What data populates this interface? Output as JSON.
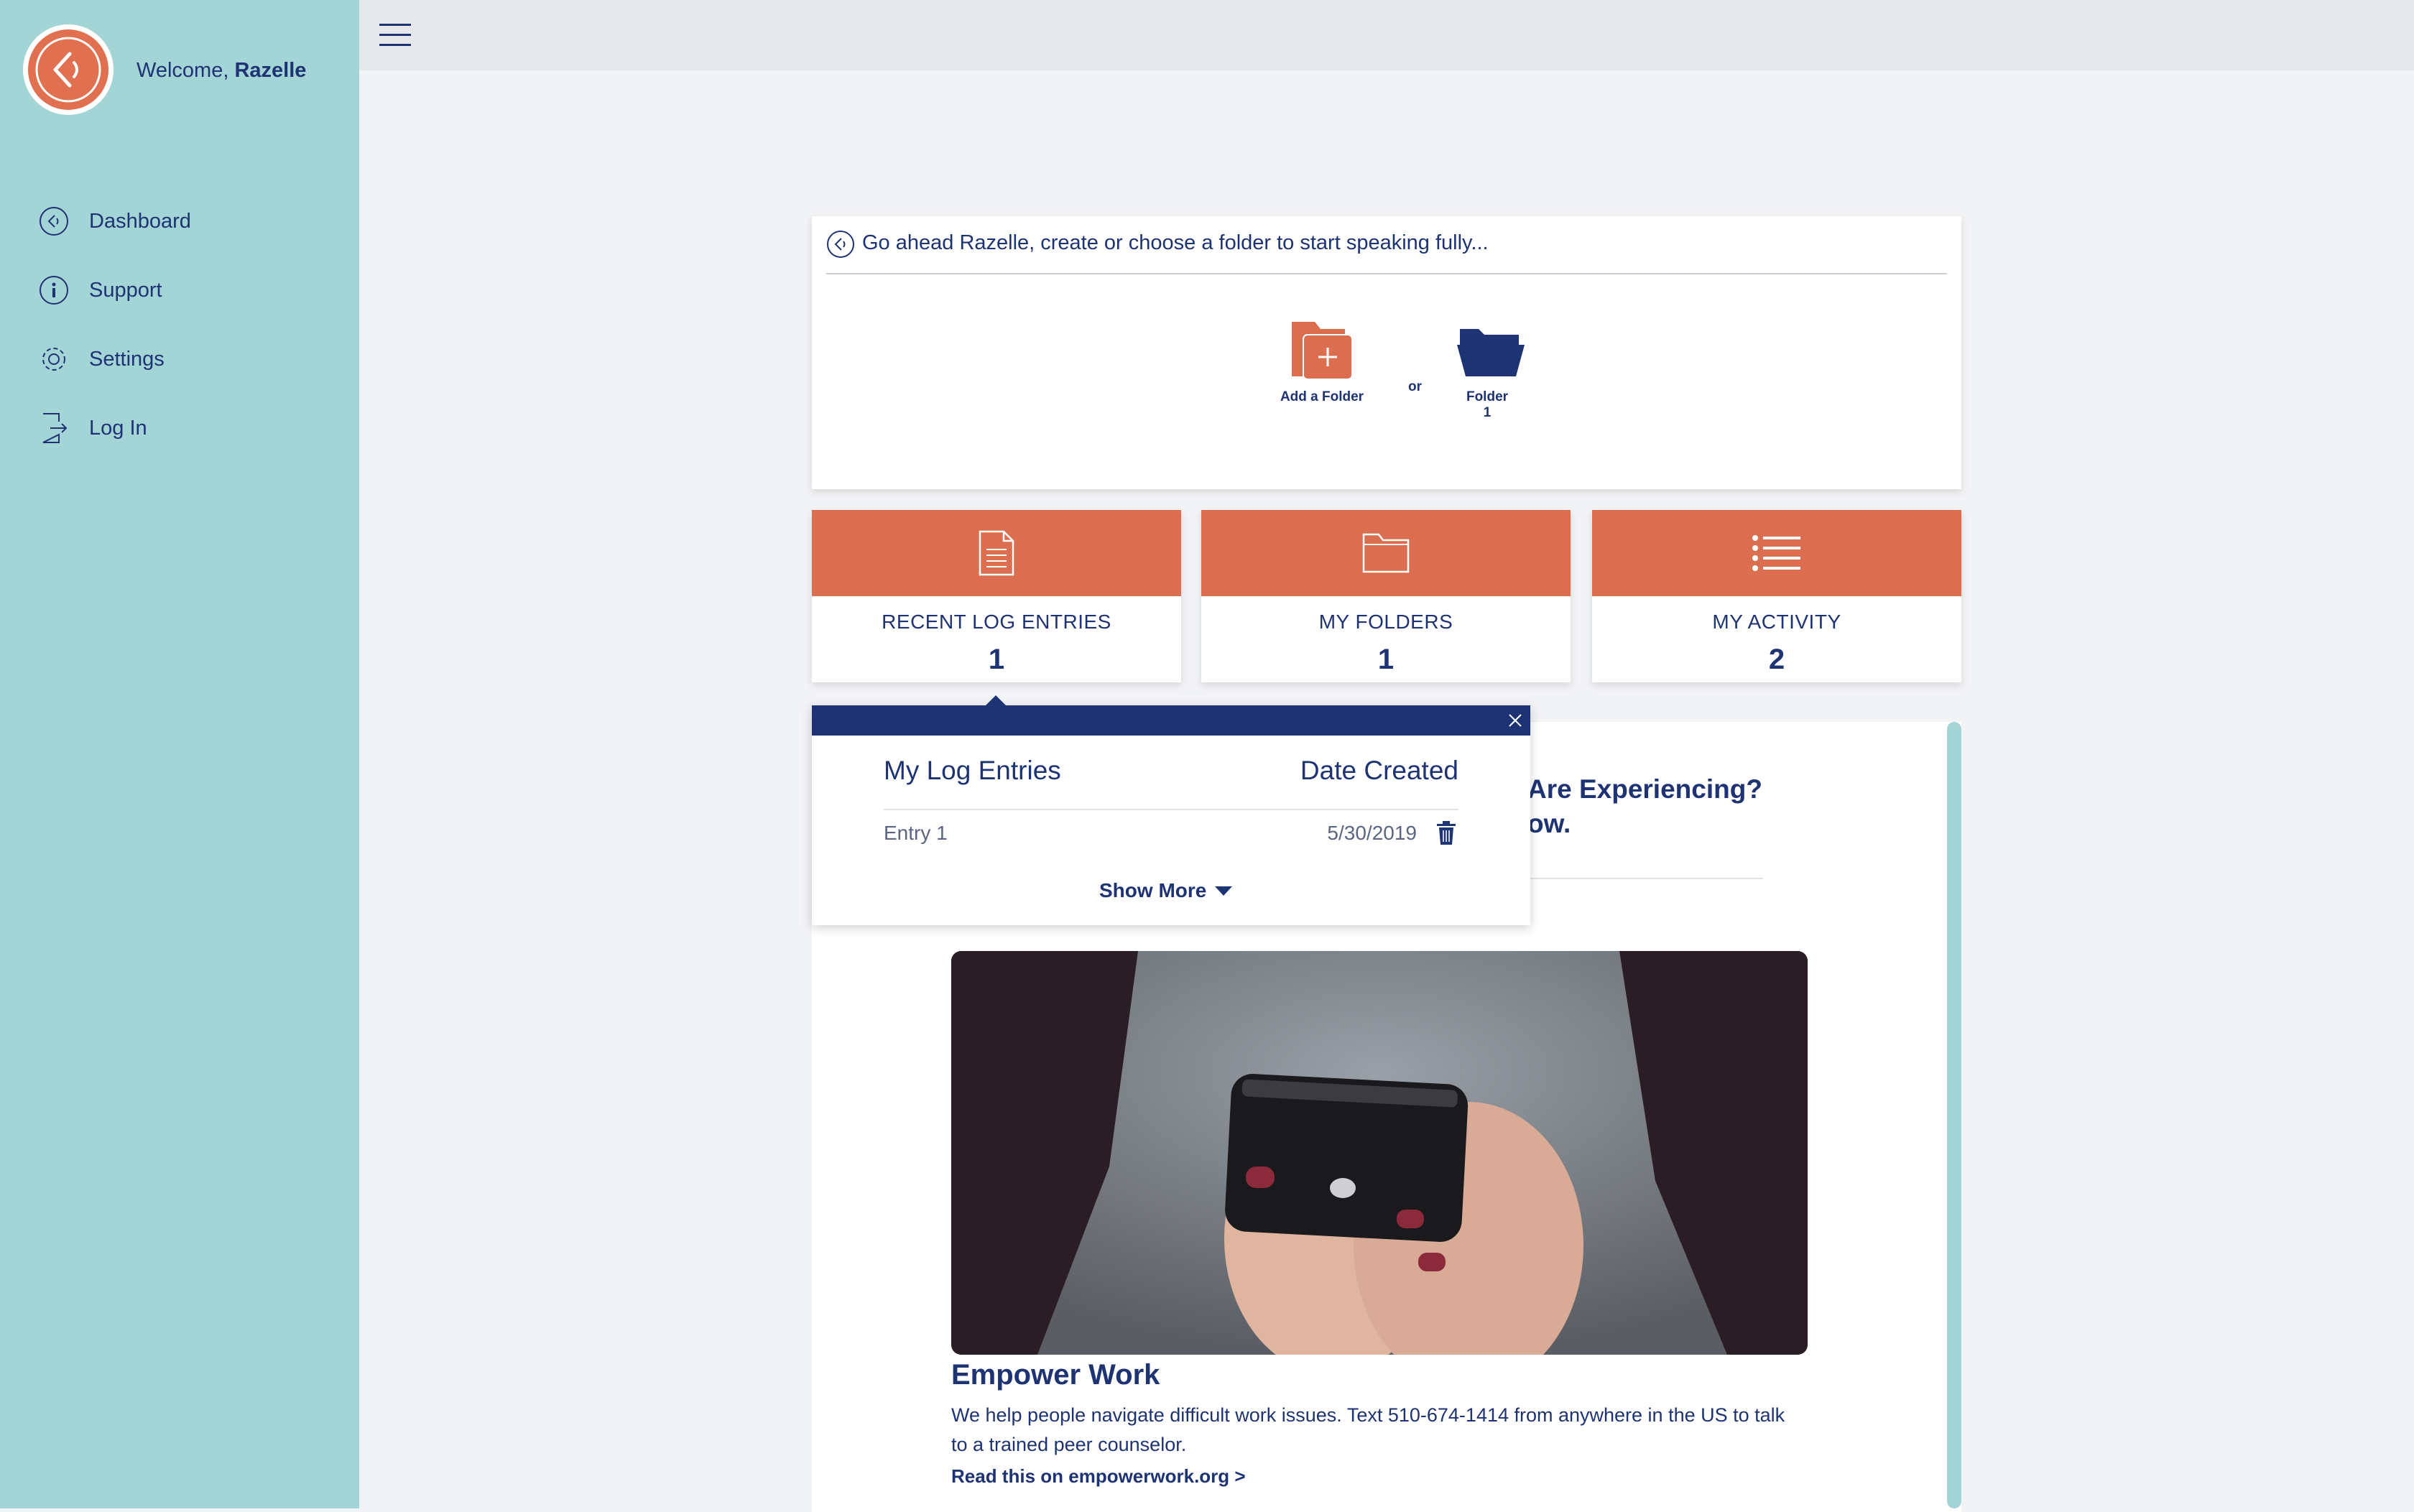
{
  "sidebar": {
    "welcome_prefix": "Welcome, ",
    "user_name": "Razelle",
    "nav": [
      {
        "label": "Dashboard",
        "icon": "back-circle-icon"
      },
      {
        "label": "Support",
        "icon": "info-icon"
      },
      {
        "label": "Settings",
        "icon": "gear-icon"
      },
      {
        "label": "Log In",
        "icon": "login-door-icon"
      }
    ]
  },
  "topbar": {
    "menu_icon": "hamburger-icon"
  },
  "folders": {
    "prompt": "Go ahead Razelle, create or choose a folder to start speaking fully...",
    "add_label": "Add a Folder",
    "or_label": "or",
    "folder_name": "Folder",
    "folder_number": "1"
  },
  "stats": [
    {
      "label": "RECENT LOG ENTRIES",
      "value": "1",
      "icon": "document-icon"
    },
    {
      "label": "MY FOLDERS",
      "value": "1",
      "icon": "folder-outline-icon"
    },
    {
      "label": "MY ACTIVITY",
      "value": "2",
      "icon": "list-icon"
    }
  ],
  "popover": {
    "col_entries": "My Log Entries",
    "col_date": "Date Created",
    "rows": [
      {
        "name": "Entry 1",
        "date": "5/30/2019"
      }
    ],
    "show_more": "Show More"
  },
  "content": {
    "heading_line1": "Are Experiencing?",
    "heading_line2": "ow.",
    "article_title": "Empower Work",
    "article_body": "We help people navigate difficult work issues. Text 510-674-1414 from anywhere in the US to talk to a trained peer counselor.",
    "article_link": "Read this on empowerwork.org >"
  },
  "colors": {
    "navy": "#1e3373",
    "coral": "#dc6e50",
    "teal": "#a3d5d7"
  }
}
